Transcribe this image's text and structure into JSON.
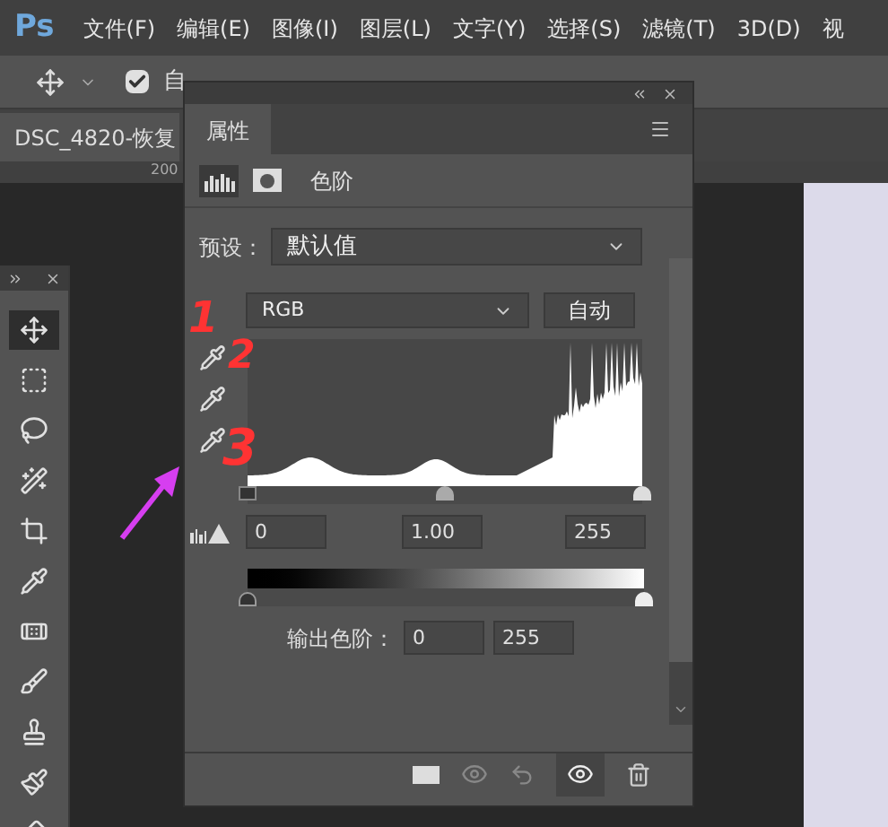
{
  "app_logo": "Ps",
  "menu": [
    "文件(F)",
    "编辑(E)",
    "图像(I)",
    "图层(L)",
    "文字(Y)",
    "选择(S)",
    "滤镜(T)",
    "3D(D)",
    "视"
  ],
  "options_bar": {
    "auto_select": {
      "label": "自",
      "checked": true
    }
  },
  "document_tab": "DSC_4820-恢复",
  "ruler_label": "200",
  "tools": [
    {
      "kind": "move",
      "selected": true
    },
    {
      "kind": "marquee",
      "selected": false
    },
    {
      "kind": "lasso",
      "selected": false
    },
    {
      "kind": "wand",
      "selected": false
    },
    {
      "kind": "crop",
      "selected": false
    },
    {
      "kind": "eyedropper",
      "selected": false
    },
    {
      "kind": "patch",
      "selected": false
    },
    {
      "kind": "brush",
      "selected": false
    },
    {
      "kind": "stamp",
      "selected": false
    },
    {
      "kind": "history",
      "selected": false
    },
    {
      "kind": "eraser",
      "selected": false
    }
  ],
  "panel": {
    "tab": "属性",
    "adjustment": "色阶",
    "preset_label": "预设：",
    "preset": "默认值",
    "channel": "RGB",
    "auto_button": "自动",
    "input_levels": [
      "0",
      "1.00",
      "255"
    ],
    "input_sliders": [
      {
        "level": 0
      },
      {
        "level": 0.5
      },
      {
        "level": 1
      }
    ],
    "output_sliders": [
      {
        "level": 0
      },
      {
        "level": 1
      }
    ],
    "output_label": "输出色阶：",
    "output_levels": [
      "0",
      "255"
    ]
  },
  "annotations": [
    "1",
    "2",
    "3"
  ]
}
